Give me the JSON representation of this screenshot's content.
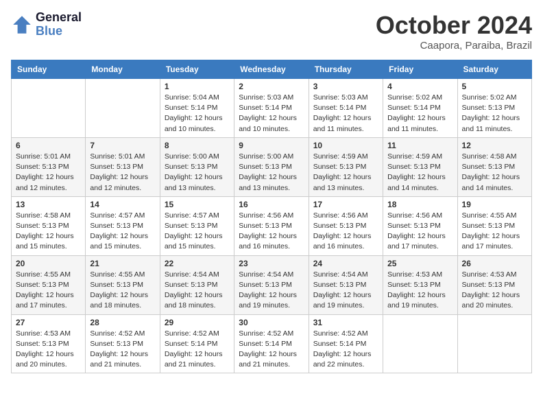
{
  "header": {
    "logo_line1": "General",
    "logo_line2": "Blue",
    "month": "October 2024",
    "location": "Caapora, Paraiba, Brazil"
  },
  "weekdays": [
    "Sunday",
    "Monday",
    "Tuesday",
    "Wednesday",
    "Thursday",
    "Friday",
    "Saturday"
  ],
  "weeks": [
    [
      {
        "day": "",
        "sunrise": "",
        "sunset": "",
        "daylight": ""
      },
      {
        "day": "",
        "sunrise": "",
        "sunset": "",
        "daylight": ""
      },
      {
        "day": "1",
        "sunrise": "Sunrise: 5:04 AM",
        "sunset": "Sunset: 5:14 PM",
        "daylight": "Daylight: 12 hours and 10 minutes."
      },
      {
        "day": "2",
        "sunrise": "Sunrise: 5:03 AM",
        "sunset": "Sunset: 5:14 PM",
        "daylight": "Daylight: 12 hours and 10 minutes."
      },
      {
        "day": "3",
        "sunrise": "Sunrise: 5:03 AM",
        "sunset": "Sunset: 5:14 PM",
        "daylight": "Daylight: 12 hours and 11 minutes."
      },
      {
        "day": "4",
        "sunrise": "Sunrise: 5:02 AM",
        "sunset": "Sunset: 5:14 PM",
        "daylight": "Daylight: 12 hours and 11 minutes."
      },
      {
        "day": "5",
        "sunrise": "Sunrise: 5:02 AM",
        "sunset": "Sunset: 5:13 PM",
        "daylight": "Daylight: 12 hours and 11 minutes."
      }
    ],
    [
      {
        "day": "6",
        "sunrise": "Sunrise: 5:01 AM",
        "sunset": "Sunset: 5:13 PM",
        "daylight": "Daylight: 12 hours and 12 minutes."
      },
      {
        "day": "7",
        "sunrise": "Sunrise: 5:01 AM",
        "sunset": "Sunset: 5:13 PM",
        "daylight": "Daylight: 12 hours and 12 minutes."
      },
      {
        "day": "8",
        "sunrise": "Sunrise: 5:00 AM",
        "sunset": "Sunset: 5:13 PM",
        "daylight": "Daylight: 12 hours and 13 minutes."
      },
      {
        "day": "9",
        "sunrise": "Sunrise: 5:00 AM",
        "sunset": "Sunset: 5:13 PM",
        "daylight": "Daylight: 12 hours and 13 minutes."
      },
      {
        "day": "10",
        "sunrise": "Sunrise: 4:59 AM",
        "sunset": "Sunset: 5:13 PM",
        "daylight": "Daylight: 12 hours and 13 minutes."
      },
      {
        "day": "11",
        "sunrise": "Sunrise: 4:59 AM",
        "sunset": "Sunset: 5:13 PM",
        "daylight": "Daylight: 12 hours and 14 minutes."
      },
      {
        "day": "12",
        "sunrise": "Sunrise: 4:58 AM",
        "sunset": "Sunset: 5:13 PM",
        "daylight": "Daylight: 12 hours and 14 minutes."
      }
    ],
    [
      {
        "day": "13",
        "sunrise": "Sunrise: 4:58 AM",
        "sunset": "Sunset: 5:13 PM",
        "daylight": "Daylight: 12 hours and 15 minutes."
      },
      {
        "day": "14",
        "sunrise": "Sunrise: 4:57 AM",
        "sunset": "Sunset: 5:13 PM",
        "daylight": "Daylight: 12 hours and 15 minutes."
      },
      {
        "day": "15",
        "sunrise": "Sunrise: 4:57 AM",
        "sunset": "Sunset: 5:13 PM",
        "daylight": "Daylight: 12 hours and 15 minutes."
      },
      {
        "day": "16",
        "sunrise": "Sunrise: 4:56 AM",
        "sunset": "Sunset: 5:13 PM",
        "daylight": "Daylight: 12 hours and 16 minutes."
      },
      {
        "day": "17",
        "sunrise": "Sunrise: 4:56 AM",
        "sunset": "Sunset: 5:13 PM",
        "daylight": "Daylight: 12 hours and 16 minutes."
      },
      {
        "day": "18",
        "sunrise": "Sunrise: 4:56 AM",
        "sunset": "Sunset: 5:13 PM",
        "daylight": "Daylight: 12 hours and 17 minutes."
      },
      {
        "day": "19",
        "sunrise": "Sunrise: 4:55 AM",
        "sunset": "Sunset: 5:13 PM",
        "daylight": "Daylight: 12 hours and 17 minutes."
      }
    ],
    [
      {
        "day": "20",
        "sunrise": "Sunrise: 4:55 AM",
        "sunset": "Sunset: 5:13 PM",
        "daylight": "Daylight: 12 hours and 17 minutes."
      },
      {
        "day": "21",
        "sunrise": "Sunrise: 4:55 AM",
        "sunset": "Sunset: 5:13 PM",
        "daylight": "Daylight: 12 hours and 18 minutes."
      },
      {
        "day": "22",
        "sunrise": "Sunrise: 4:54 AM",
        "sunset": "Sunset: 5:13 PM",
        "daylight": "Daylight: 12 hours and 18 minutes."
      },
      {
        "day": "23",
        "sunrise": "Sunrise: 4:54 AM",
        "sunset": "Sunset: 5:13 PM",
        "daylight": "Daylight: 12 hours and 19 minutes."
      },
      {
        "day": "24",
        "sunrise": "Sunrise: 4:54 AM",
        "sunset": "Sunset: 5:13 PM",
        "daylight": "Daylight: 12 hours and 19 minutes."
      },
      {
        "day": "25",
        "sunrise": "Sunrise: 4:53 AM",
        "sunset": "Sunset: 5:13 PM",
        "daylight": "Daylight: 12 hours and 19 minutes."
      },
      {
        "day": "26",
        "sunrise": "Sunrise: 4:53 AM",
        "sunset": "Sunset: 5:13 PM",
        "daylight": "Daylight: 12 hours and 20 minutes."
      }
    ],
    [
      {
        "day": "27",
        "sunrise": "Sunrise: 4:53 AM",
        "sunset": "Sunset: 5:13 PM",
        "daylight": "Daylight: 12 hours and 20 minutes."
      },
      {
        "day": "28",
        "sunrise": "Sunrise: 4:52 AM",
        "sunset": "Sunset: 5:13 PM",
        "daylight": "Daylight: 12 hours and 21 minutes."
      },
      {
        "day": "29",
        "sunrise": "Sunrise: 4:52 AM",
        "sunset": "Sunset: 5:14 PM",
        "daylight": "Daylight: 12 hours and 21 minutes."
      },
      {
        "day": "30",
        "sunrise": "Sunrise: 4:52 AM",
        "sunset": "Sunset: 5:14 PM",
        "daylight": "Daylight: 12 hours and 21 minutes."
      },
      {
        "day": "31",
        "sunrise": "Sunrise: 4:52 AM",
        "sunset": "Sunset: 5:14 PM",
        "daylight": "Daylight: 12 hours and 22 minutes."
      },
      {
        "day": "",
        "sunrise": "",
        "sunset": "",
        "daylight": ""
      },
      {
        "day": "",
        "sunrise": "",
        "sunset": "",
        "daylight": ""
      }
    ]
  ]
}
